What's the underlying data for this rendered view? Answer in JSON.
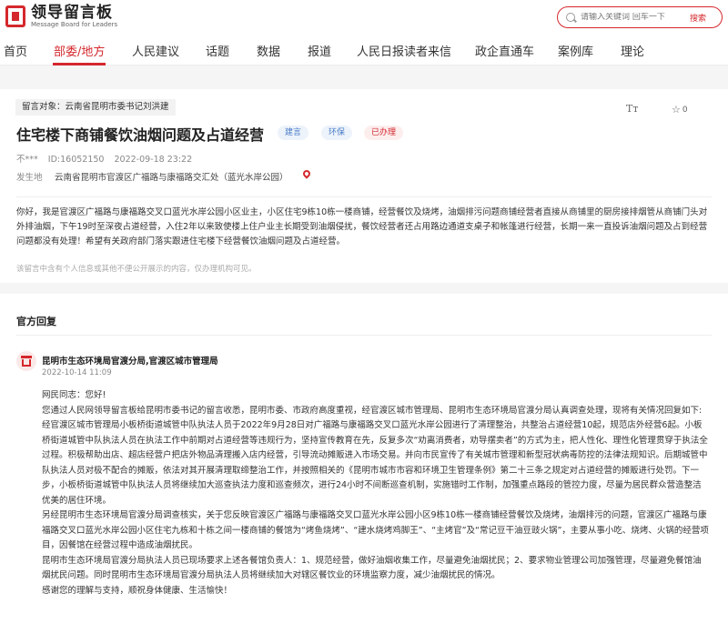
{
  "header": {
    "logo_title": "领导留言板",
    "logo_subtitle": "Message Board for Leaders",
    "search_placeholder": "请输入关键词 回车一下",
    "search_button": "搜索"
  },
  "nav": {
    "items": [
      "首页",
      "部委/地方",
      "人民建议",
      "话题",
      "数据",
      "报道",
      "人民日报读者来信",
      "政企直通车",
      "案例库",
      "理论"
    ],
    "active_index": 1
  },
  "message": {
    "target": "留言对象：云南省昆明市委书记刘洪建",
    "font_toggle": "Tт",
    "like_count": "0",
    "title": "住宅楼下商铺餐饮油烟问题及占道经营",
    "tags": [
      "建言",
      "环保",
      "已办理"
    ],
    "author": "不***",
    "id": "ID:16052150",
    "time": "2022-09-18 23:22",
    "location_label": "发生地",
    "location": "云南省昆明市官渡区广福路与康福路交汇处（蓝光水岸公园）",
    "body": "你好，我是官渡区广福路与康福路交叉口蓝光水岸公园小区业主，小区住宅9栋10栋一楼商铺，经营餐饮及烧烤，油烟排污问题商铺经营者直接从商铺里的厨房接排烟管从商铺门头对外排油烟，下午19时至深夜占道经营，入住2年以来致使楼上住户业主长期受到油烟侵扰，餐饮经营者还占用路边通道支桌子和帐篷进行经营，长期一来一直投诉油烟问题及占到经营问题都没有处理！希望有关政府部门落实跟进住宅楼下经营餐饮油烟问题及占道经营。",
    "notice": "该留言中含有个人信息或其他不便公开展示的内容，仅办理机构可见。"
  },
  "reply": {
    "heading": "官方回复",
    "org": "昆明市生态环境局官渡分局,官渡区城市管理局",
    "time": "2022-10-14 11:09",
    "paragraphs": [
      "网民同志：您好!",
      "您通过人民网领导留言板给昆明市委书记的留言收悉，昆明市委、市政府高度重视，经官渡区城市管理局、昆明市生态环境局官渡分局认真调查处理，现将有关情况回复如下:",
      "经官渡区城市管理局小板桥街道城管中队执法人员于2022年9月28日对广福路与康福路交叉口蓝光水岸公园进行了清理整治，共整治占道经营10起，规范店外经营6起。小板桥街道城管中队执法人员在执法工作中前期对占道经营等违规行为，坚持宣传教育在先，反复多次“劝离消费者，劝导摆卖者”的方式为主，把人性化、理性化管理贯穿于执法全过程。积极帮助出店、超店经营户把店外物品清理搬入店内经营，引导流动摊贩进入市场交易。并向市民宣传了有关城市管理和新型冠状病毒防控的法律法规知识。后期城管中队执法人员对极不配合的摊贩，依法对其开展清理取缔整治工作，并按照相关的《昆明市城市市容和环境卫生管理条例》第二十三条之规定对占道经营的摊贩进行处罚。下一步，小板桥街道城管中队执法人员将继续加大巡查执法力度和巡查频次，进行24小时不间断巡查机制，实施错时工作制，加强重点路段的管控力度，尽量为居民群众营造整洁优美的居住环境。",
      "另经昆明市生态环境局官渡分局调查核实，关于您反映官渡区广福路与康福路交叉口蓝光水岸公园小区9栋10栋一楼商铺经营餐饮及烧烤，油烟排污的问题，官渡区广福路与康福路交叉口蓝光水岸公园小区住宅九栋和十栋之间一楼商铺的餐馆为“烤鱼烧烤”、“建水烧烤鸡脚王”、“主烤官”及“常记豆干油豆豉火锅”，主要从事小吃、烧烤、火锅的经营项目，因餐馆在经营过程中造成油烟扰民。",
      "昆明市生态环境局官渡分局执法人员已现场要求上述各餐馆负责人：1、规范经营，做好油烟收集工作，尽量避免油烟扰民；2、要求物业管理公司加强管理，尽量避免餐馆油烟扰民问题。同时昆明市生态环境局官渡分局执法人员将继续加大对辖区餐饮业的环境监察力度，减少油烟扰民的情况。",
      "感谢您的理解与支持，顺祝身体健康、生活愉快！"
    ]
  },
  "colors": {
    "brand_red": "#d4282d",
    "tag_blue": "#4a7cc7"
  }
}
